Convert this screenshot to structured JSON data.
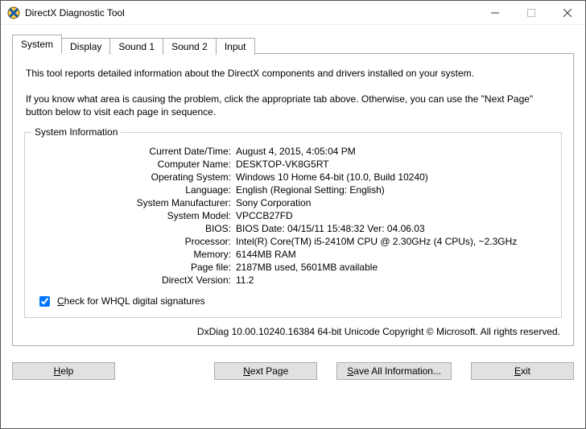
{
  "window": {
    "title": "DirectX Diagnostic Tool"
  },
  "tabs": {
    "system": "System",
    "display": "Display",
    "sound1": "Sound 1",
    "sound2": "Sound 2",
    "input": "Input"
  },
  "intro": {
    "p1": "This tool reports detailed information about the DirectX components and drivers installed on your system.",
    "p2": "If you know what area is causing the problem, click the appropriate tab above.  Otherwise, you can use the \"Next Page\" button below to visit each page in sequence."
  },
  "group": {
    "legend": "System Information"
  },
  "labels": {
    "datetime": "Current Date/Time:",
    "computer": "Computer Name:",
    "os": "Operating System:",
    "language": "Language:",
    "manufacturer": "System Manufacturer:",
    "model": "System Model:",
    "bios": "BIOS:",
    "processor": "Processor:",
    "memory": "Memory:",
    "pagefile": "Page file:",
    "dxversion": "DirectX Version:"
  },
  "values": {
    "datetime": "August 4, 2015, 4:05:04 PM",
    "computer": "DESKTOP-VK8G5RT",
    "os": "Windows 10 Home 64-bit (10.0, Build 10240)",
    "language": "English (Regional Setting: English)",
    "manufacturer": "Sony Corporation",
    "model": "VPCCB27FD",
    "bios": "BIOS Date: 04/15/11 15:48:32 Ver: 04.06.03",
    "processor": "Intel(R) Core(TM) i5-2410M CPU @ 2.30GHz (4 CPUs), ~2.3GHz",
    "memory": "6144MB RAM",
    "pagefile": "2187MB used, 5601MB available",
    "dxversion": "11.2"
  },
  "whql": {
    "checked": true,
    "label_rest": "heck for WHQL digital signatures"
  },
  "footer": "DxDiag 10.00.10240.16384 64-bit Unicode   Copyright © Microsoft. All rights reserved.",
  "buttons": {
    "help_rest": "elp",
    "next_rest": "ext Page",
    "save_rest": "ave All Information...",
    "exit_rest": "xit"
  }
}
